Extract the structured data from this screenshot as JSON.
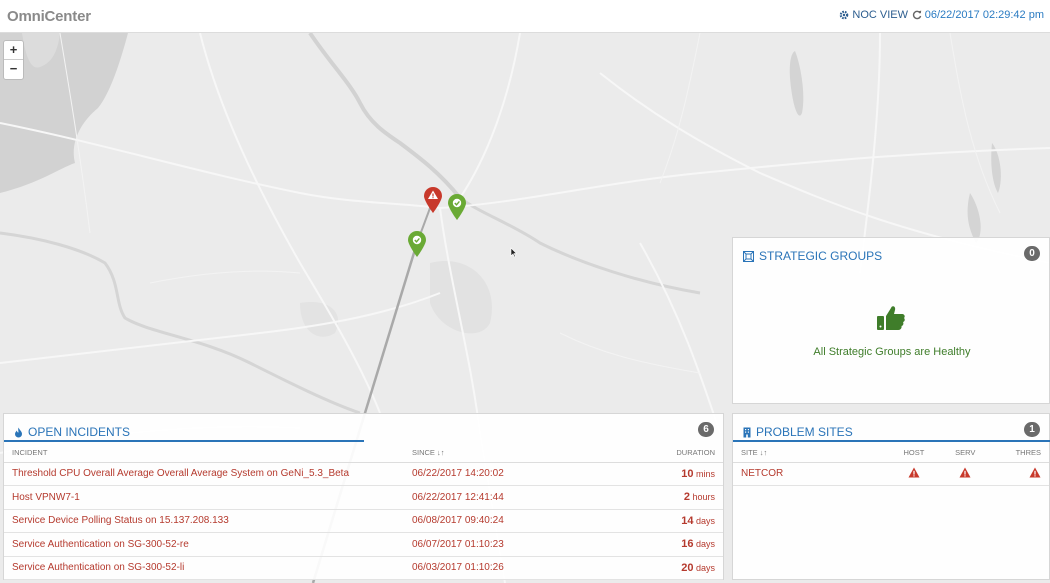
{
  "header": {
    "logo": "OmniCenter",
    "noc_view": "NOC VIEW",
    "timestamp": "06/22/2017 02:29:42 pm"
  },
  "map": {
    "zoom_in": "+",
    "zoom_out": "−"
  },
  "strategic_groups": {
    "title": "STRATEGIC GROUPS",
    "count": "0",
    "message": "All Strategic Groups are Healthy"
  },
  "open_incidents": {
    "title": "OPEN INCIDENTS",
    "count": "6",
    "columns": {
      "incident": "INCIDENT",
      "since": "SINCE ↓↑",
      "duration": "DURATION"
    },
    "rows": [
      {
        "incident": "Threshold CPU Overall Average Overall Average System on GeNi_5.3_Beta",
        "since": "06/22/2017 14:20:02",
        "duration_value": "10",
        "duration_unit": "mins"
      },
      {
        "incident": "Host VPNW7-1",
        "since": "06/22/2017 12:41:44",
        "duration_value": "2",
        "duration_unit": "hours"
      },
      {
        "incident": "Service Device Polling Status on 15.137.208.133",
        "since": "06/08/2017 09:40:24",
        "duration_value": "14",
        "duration_unit": "days"
      },
      {
        "incident": "Service Authentication on SG-300-52-re",
        "since": "06/07/2017 01:10:23",
        "duration_value": "16",
        "duration_unit": "days"
      },
      {
        "incident": "Service Authentication on SG-300-52-li",
        "since": "06/03/2017 01:10:26",
        "duration_value": "20",
        "duration_unit": "days"
      }
    ]
  },
  "problem_sites": {
    "title": "PROBLEM SITES",
    "count": "1",
    "columns": {
      "site": "SITE ↓↑",
      "host": "HOST",
      "serv": "SERV",
      "thres": "THRES"
    },
    "rows": [
      {
        "site": "NETCOR",
        "host": "warning-icon",
        "serv": "warning-icon",
        "thres": "warning-icon"
      }
    ]
  },
  "colors": {
    "accent": "#2a74b8",
    "alert": "#c8392b",
    "healthy": "#6aaa35"
  }
}
